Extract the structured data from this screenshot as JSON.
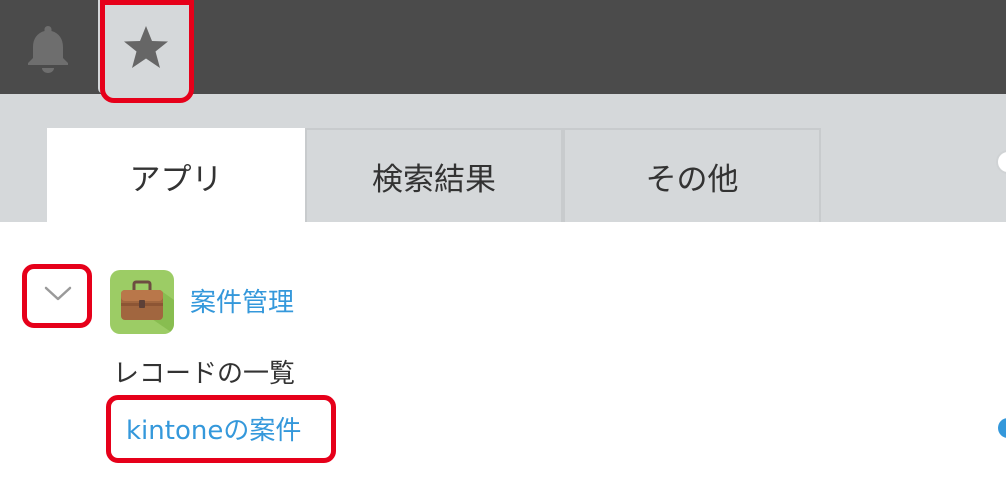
{
  "header": {
    "bell_icon": "bell-icon",
    "star_icon": "star-icon"
  },
  "tabs": [
    {
      "label": "アプリ",
      "active": true
    },
    {
      "label": "検索結果",
      "active": false
    },
    {
      "label": "その他",
      "active": false
    }
  ],
  "favorites": {
    "app_name": "案件管理",
    "app_icon": "briefcase-icon",
    "view_section_label": "レコードの一覧",
    "view_link": "kintoneの案件"
  },
  "colors": {
    "topbar": "#4b4b4b",
    "tabbar": "#d5d8da",
    "link": "#3498db",
    "highlight": "#e6001a",
    "app_icon_bg": "#9ccc65"
  }
}
